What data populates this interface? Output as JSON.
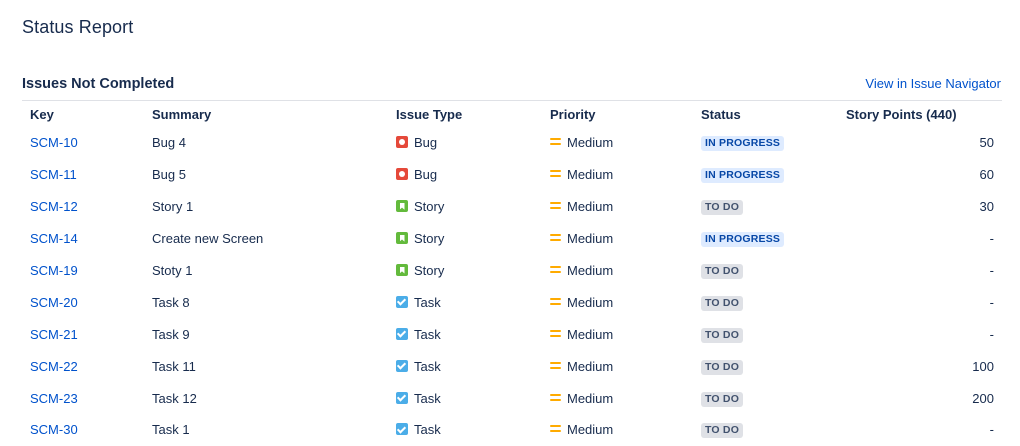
{
  "page": {
    "title": "Status Report"
  },
  "section": {
    "title": "Issues Not Completed",
    "navigator_link": "View in Issue Navigator"
  },
  "table": {
    "headers": {
      "key": "Key",
      "summary": "Summary",
      "issue_type": "Issue Type",
      "priority": "Priority",
      "status": "Status",
      "story_points": "Story Points (440)"
    },
    "rows": [
      {
        "key": "SCM-10",
        "summary": "Bug 4",
        "type": "Bug",
        "type_icon": "bug-icon",
        "priority": "Medium",
        "status": "IN PROGRESS",
        "points": "50"
      },
      {
        "key": "SCM-11",
        "summary": "Bug 5",
        "type": "Bug",
        "type_icon": "bug-icon",
        "priority": "Medium",
        "status": "IN PROGRESS",
        "points": "60"
      },
      {
        "key": "SCM-12",
        "summary": "Story 1",
        "type": "Story",
        "type_icon": "story-icon",
        "priority": "Medium",
        "status": "TO DO",
        "points": "30"
      },
      {
        "key": "SCM-14",
        "summary": "Create new Screen",
        "type": "Story",
        "type_icon": "story-icon",
        "priority": "Medium",
        "status": "IN PROGRESS",
        "points": "-"
      },
      {
        "key": "SCM-19",
        "summary": "Stoty 1",
        "type": "Story",
        "type_icon": "story-icon",
        "priority": "Medium",
        "status": "TO DO",
        "points": "-"
      },
      {
        "key": "SCM-20",
        "summary": "Task 8",
        "type": "Task",
        "type_icon": "task-icon",
        "priority": "Medium",
        "status": "TO DO",
        "points": "-"
      },
      {
        "key": "SCM-21",
        "summary": "Task 9",
        "type": "Task",
        "type_icon": "task-icon",
        "priority": "Medium",
        "status": "TO DO",
        "points": "-"
      },
      {
        "key": "SCM-22",
        "summary": "Task 11",
        "type": "Task",
        "type_icon": "task-icon",
        "priority": "Medium",
        "status": "TO DO",
        "points": "100"
      },
      {
        "key": "SCM-23",
        "summary": "Task 12",
        "type": "Task",
        "type_icon": "task-icon",
        "priority": "Medium",
        "status": "TO DO",
        "points": "200"
      },
      {
        "key": "SCM-30",
        "summary": "Task 1",
        "type": "Task",
        "type_icon": "task-icon",
        "priority": "Medium",
        "status": "TO DO",
        "points": "-"
      }
    ]
  },
  "colors": {
    "link": "#0052cc",
    "bug": "#e5493a",
    "story": "#63ba3c",
    "task": "#4bade8",
    "priority_medium": "#ffab00",
    "in_progress_bg": "#deebff",
    "todo_bg": "#dfe1e6"
  }
}
